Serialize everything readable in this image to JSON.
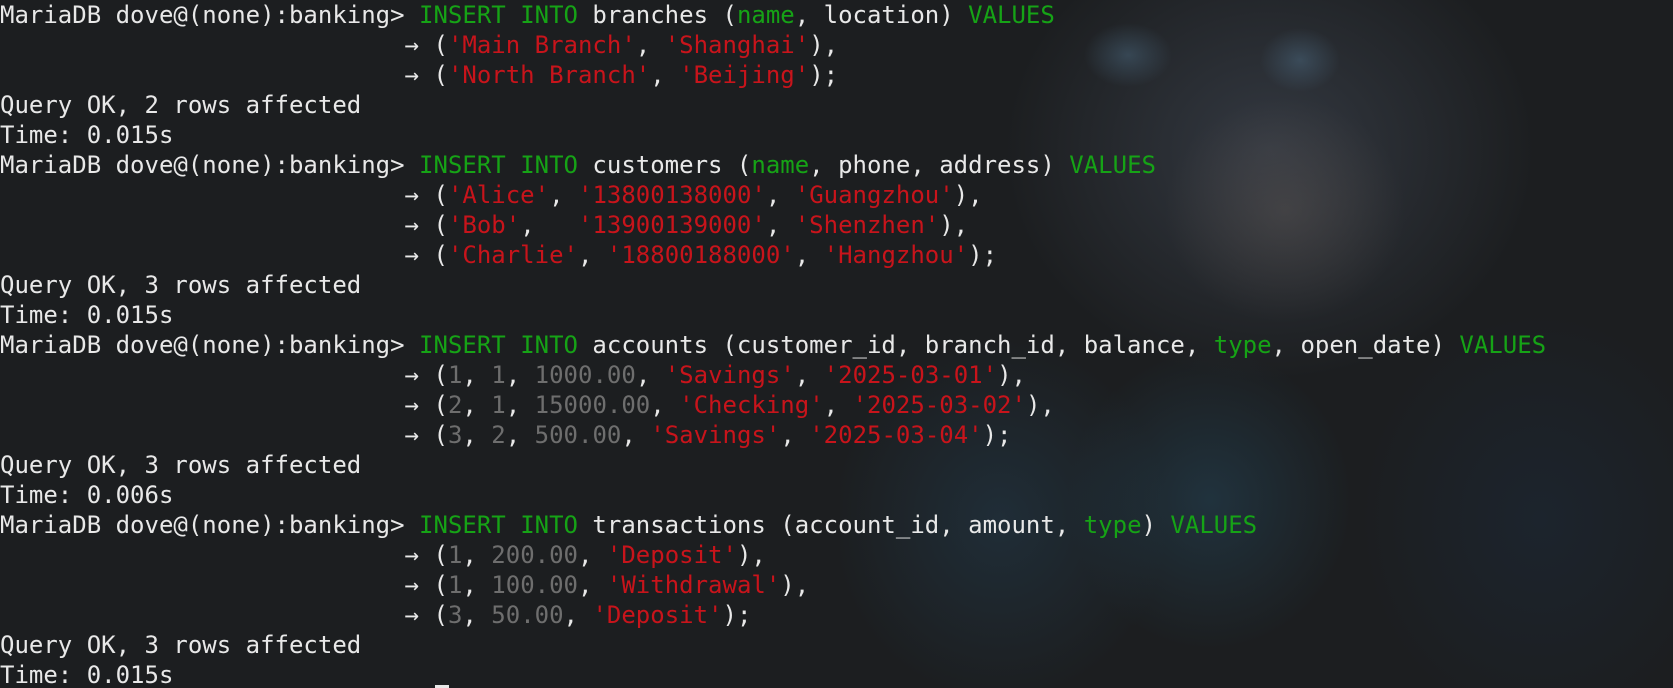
{
  "terminal": {
    "prompt": "MariaDB dove@(none):banking> ",
    "continuation": "                            → ",
    "statements": [
      {
        "lines": [
          [
            [
              "kw",
              "INSERT"
            ],
            [
              "id",
              " "
            ],
            [
              "kw",
              "INTO"
            ],
            [
              "id",
              " branches ("
            ],
            [
              "kw",
              "name"
            ],
            [
              "id",
              ", location) "
            ],
            [
              "kw",
              "VALUES"
            ]
          ],
          [
            [
              "id",
              "("
            ],
            [
              "str",
              "'Main Branch'"
            ],
            [
              "id",
              ", "
            ],
            [
              "str",
              "'Shanghai'"
            ],
            [
              "id",
              "),"
            ]
          ],
          [
            [
              "id",
              "("
            ],
            [
              "str",
              "'North Branch'"
            ],
            [
              "id",
              ", "
            ],
            [
              "str",
              "'Beijing'"
            ],
            [
              "id",
              ");"
            ]
          ]
        ],
        "result": "Query OK, 2 rows affected",
        "time": "Time: 0.015s"
      },
      {
        "lines": [
          [
            [
              "kw",
              "INSERT"
            ],
            [
              "id",
              " "
            ],
            [
              "kw",
              "INTO"
            ],
            [
              "id",
              " customers ("
            ],
            [
              "kw",
              "name"
            ],
            [
              "id",
              ", phone, address) "
            ],
            [
              "kw",
              "VALUES"
            ]
          ],
          [
            [
              "id",
              "("
            ],
            [
              "str",
              "'Alice'"
            ],
            [
              "id",
              ", "
            ],
            [
              "str",
              "'13800138000'"
            ],
            [
              "id",
              ", "
            ],
            [
              "str",
              "'Guangzhou'"
            ],
            [
              "id",
              "),"
            ]
          ],
          [
            [
              "id",
              "("
            ],
            [
              "str",
              "'Bob'"
            ],
            [
              "id",
              ",   "
            ],
            [
              "str",
              "'13900139000'"
            ],
            [
              "id",
              ", "
            ],
            [
              "str",
              "'Shenzhen'"
            ],
            [
              "id",
              "),"
            ]
          ],
          [
            [
              "id",
              "("
            ],
            [
              "str",
              "'Charlie'"
            ],
            [
              "id",
              ", "
            ],
            [
              "str",
              "'18800188000'"
            ],
            [
              "id",
              ", "
            ],
            [
              "str",
              "'Hangzhou'"
            ],
            [
              "id",
              ");"
            ]
          ]
        ],
        "result": "Query OK, 3 rows affected",
        "time": "Time: 0.015s"
      },
      {
        "lines": [
          [
            [
              "kw",
              "INSERT"
            ],
            [
              "id",
              " "
            ],
            [
              "kw",
              "INTO"
            ],
            [
              "id",
              " accounts (customer_id, branch_id, balance, "
            ],
            [
              "kw",
              "type"
            ],
            [
              "id",
              ", open_date) "
            ],
            [
              "kw",
              "VALUES"
            ]
          ],
          [
            [
              "id",
              "("
            ],
            [
              "num",
              "1"
            ],
            [
              "id",
              ", "
            ],
            [
              "num",
              "1"
            ],
            [
              "id",
              ", "
            ],
            [
              "num",
              "1000.00"
            ],
            [
              "id",
              ", "
            ],
            [
              "str",
              "'Savings'"
            ],
            [
              "id",
              ", "
            ],
            [
              "str",
              "'2025-03-01'"
            ],
            [
              "id",
              "),"
            ]
          ],
          [
            [
              "id",
              "("
            ],
            [
              "num",
              "2"
            ],
            [
              "id",
              ", "
            ],
            [
              "num",
              "1"
            ],
            [
              "id",
              ", "
            ],
            [
              "num",
              "15000.00"
            ],
            [
              "id",
              ", "
            ],
            [
              "str",
              "'Checking'"
            ],
            [
              "id",
              ", "
            ],
            [
              "str",
              "'2025-03-02'"
            ],
            [
              "id",
              "),"
            ]
          ],
          [
            [
              "id",
              "("
            ],
            [
              "num",
              "3"
            ],
            [
              "id",
              ", "
            ],
            [
              "num",
              "2"
            ],
            [
              "id",
              ", "
            ],
            [
              "num",
              "500.00"
            ],
            [
              "id",
              ", "
            ],
            [
              "str",
              "'Savings'"
            ],
            [
              "id",
              ", "
            ],
            [
              "str",
              "'2025-03-04'"
            ],
            [
              "id",
              ");"
            ]
          ]
        ],
        "result": "Query OK, 3 rows affected",
        "time": "Time: 0.006s"
      },
      {
        "lines": [
          [
            [
              "kw",
              "INSERT"
            ],
            [
              "id",
              " "
            ],
            [
              "kw",
              "INTO"
            ],
            [
              "id",
              " transactions (account_id, amount, "
            ],
            [
              "kw",
              "type"
            ],
            [
              "id",
              ") "
            ],
            [
              "kw",
              "VALUES"
            ]
          ],
          [
            [
              "id",
              "("
            ],
            [
              "num",
              "1"
            ],
            [
              "id",
              ", "
            ],
            [
              "num",
              "200.00"
            ],
            [
              "id",
              ", "
            ],
            [
              "str",
              "'Deposit'"
            ],
            [
              "id",
              "),"
            ]
          ],
          [
            [
              "id",
              "("
            ],
            [
              "num",
              "1"
            ],
            [
              "id",
              ", "
            ],
            [
              "num",
              "100.00"
            ],
            [
              "id",
              ", "
            ],
            [
              "str",
              "'Withdrawal'"
            ],
            [
              "id",
              "),"
            ]
          ],
          [
            [
              "id",
              "("
            ],
            [
              "num",
              "3"
            ],
            [
              "id",
              ", "
            ],
            [
              "num",
              "50.00"
            ],
            [
              "id",
              ", "
            ],
            [
              "str",
              "'Deposit'"
            ],
            [
              "id",
              ");"
            ]
          ]
        ],
        "result": "Query OK, 3 rows affected",
        "time": "Time: 0.015s"
      }
    ]
  },
  "colors": {
    "keyword": "#16a316",
    "string": "#c8141b",
    "number": "#6e6e6e",
    "text": "#e8e8e8",
    "background": "#1c1e20"
  }
}
